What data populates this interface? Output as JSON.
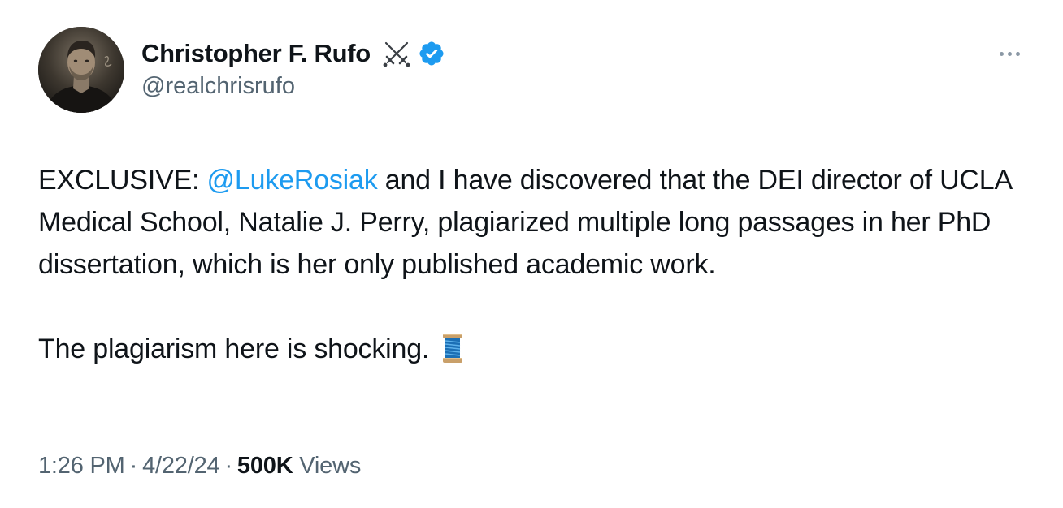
{
  "author": {
    "display_name": "Christopher F. Rufo",
    "handle": "@realchrisrufo",
    "verified": true,
    "name_emoji": "swords-icon",
    "avatar": "avatar"
  },
  "tweet": {
    "prefix": "EXCLUSIVE: ",
    "mention": "@LukeRosiak",
    "body_1": " and I have discovered that the DEI director of UCLA Medical School, Natalie J. Perry, plagiarized multiple long passages in her PhD dissertation, which is her only published academic work.",
    "body_2": "The plagiarism here is shocking.",
    "trailing_emoji": "spool-of-thread-icon"
  },
  "meta": {
    "time": "1:26 PM",
    "separator": "·",
    "date": "4/22/24",
    "views_count": "500K",
    "views_label": "Views"
  },
  "colors": {
    "text": "#0f1419",
    "secondary": "#536471",
    "link": "#1d9bf0",
    "verified": "#1d9bf0"
  }
}
